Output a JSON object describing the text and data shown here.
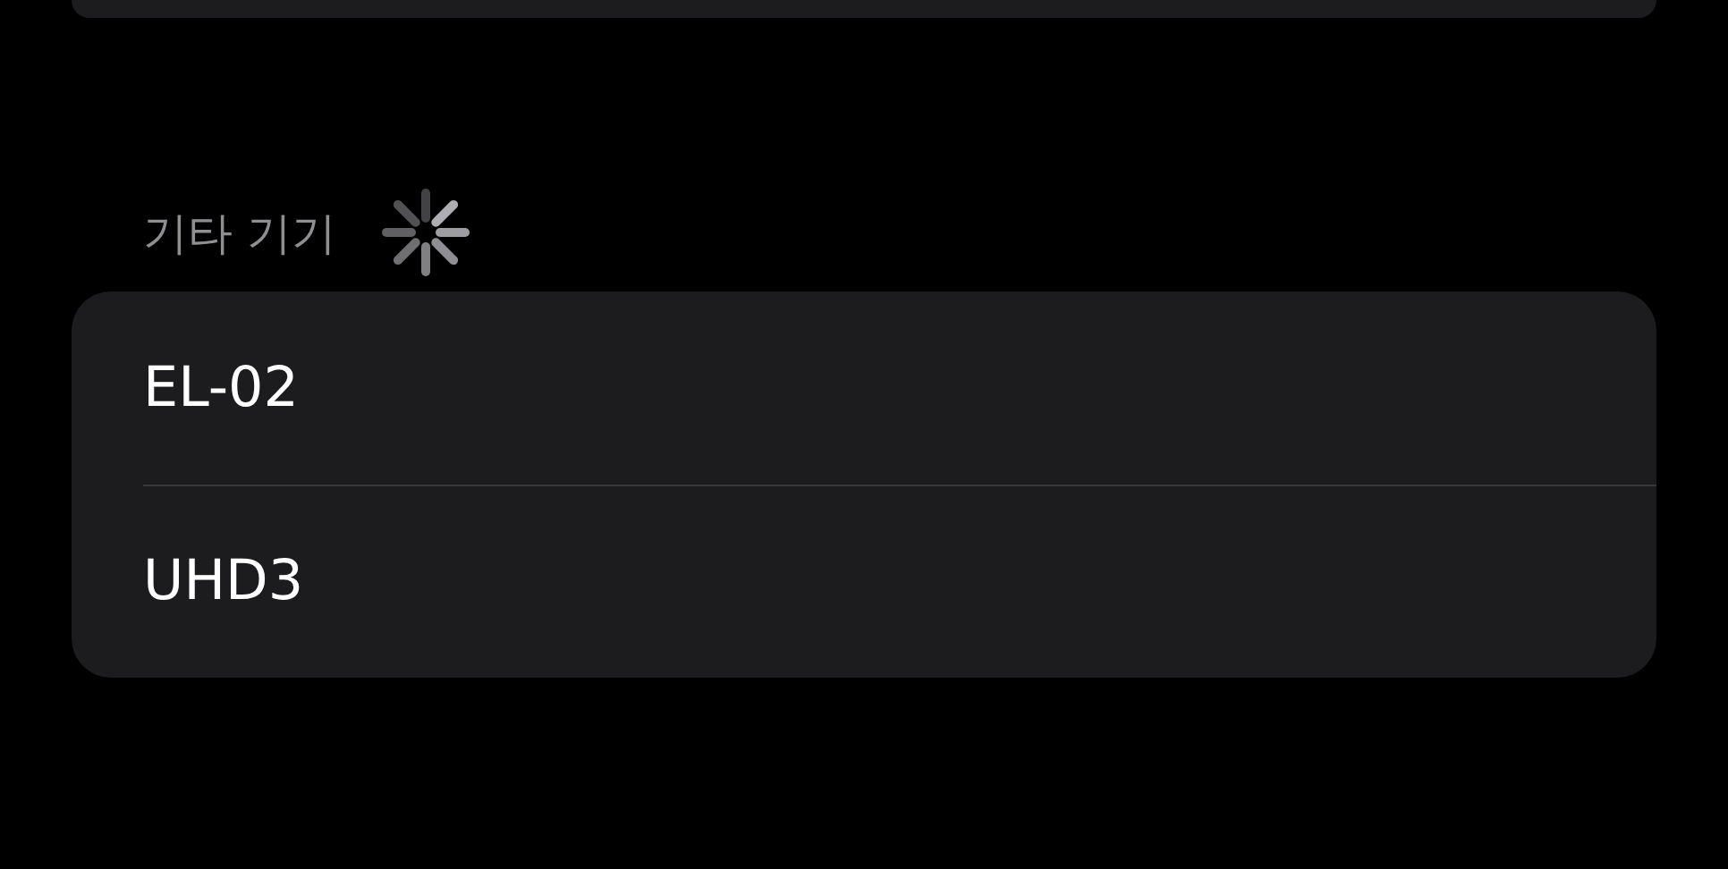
{
  "section": {
    "title": "기타 기기",
    "loading": true
  },
  "devices": [
    {
      "name": "EL-02"
    },
    {
      "name": "UHD3"
    }
  ]
}
